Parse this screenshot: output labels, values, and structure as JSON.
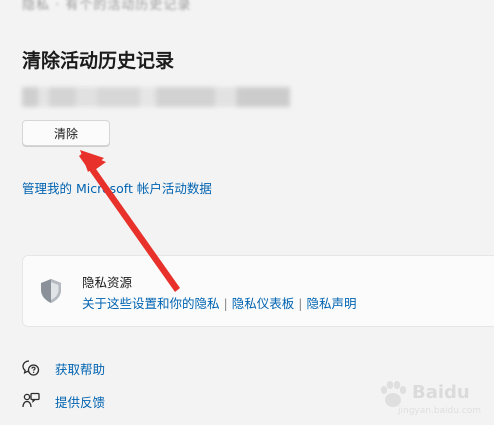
{
  "top": {
    "faded_text": "隐私 · 有个的活动历史记录"
  },
  "activity": {
    "title": "清除活动历史记录",
    "clear_button": "清除",
    "manage_link": "管理我的 Microsoft 帐户活动数据"
  },
  "privacy_resources": {
    "title": "隐私资源",
    "links": [
      "关于这些设置和你的隐私",
      "隐私仪表板",
      "隐私声明"
    ],
    "separator": "|"
  },
  "help": {
    "get_help": "获取帮助",
    "give_feedback": "提供反馈"
  },
  "watermark": {
    "text": "Baidu",
    "sub": "jingyan.baidu.com"
  },
  "colors": {
    "link": "#0063b1",
    "arrow": "#e8312a",
    "background": "#f3f3f3"
  },
  "icons": {
    "shield": "shield-icon",
    "help": "help-chat-icon",
    "feedback": "feedback-icon"
  }
}
